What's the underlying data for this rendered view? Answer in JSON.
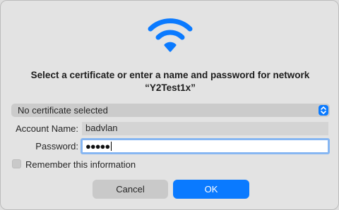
{
  "dialog": {
    "icon": "wifi-icon",
    "title_line1": "Select a certificate or enter a name and password for network",
    "title_line2": "“Y2Test1x”"
  },
  "certificate": {
    "selected": "No certificate selected"
  },
  "account": {
    "label": "Account Name:",
    "value": "badvlan"
  },
  "password": {
    "label": "Password:",
    "masked_value": "●●●●●"
  },
  "remember": {
    "label": "Remember this information",
    "checked": false
  },
  "buttons": {
    "cancel": "Cancel",
    "ok": "OK"
  },
  "colors": {
    "accent": "#0a7aff",
    "focus_ring": "#86b6f2"
  }
}
